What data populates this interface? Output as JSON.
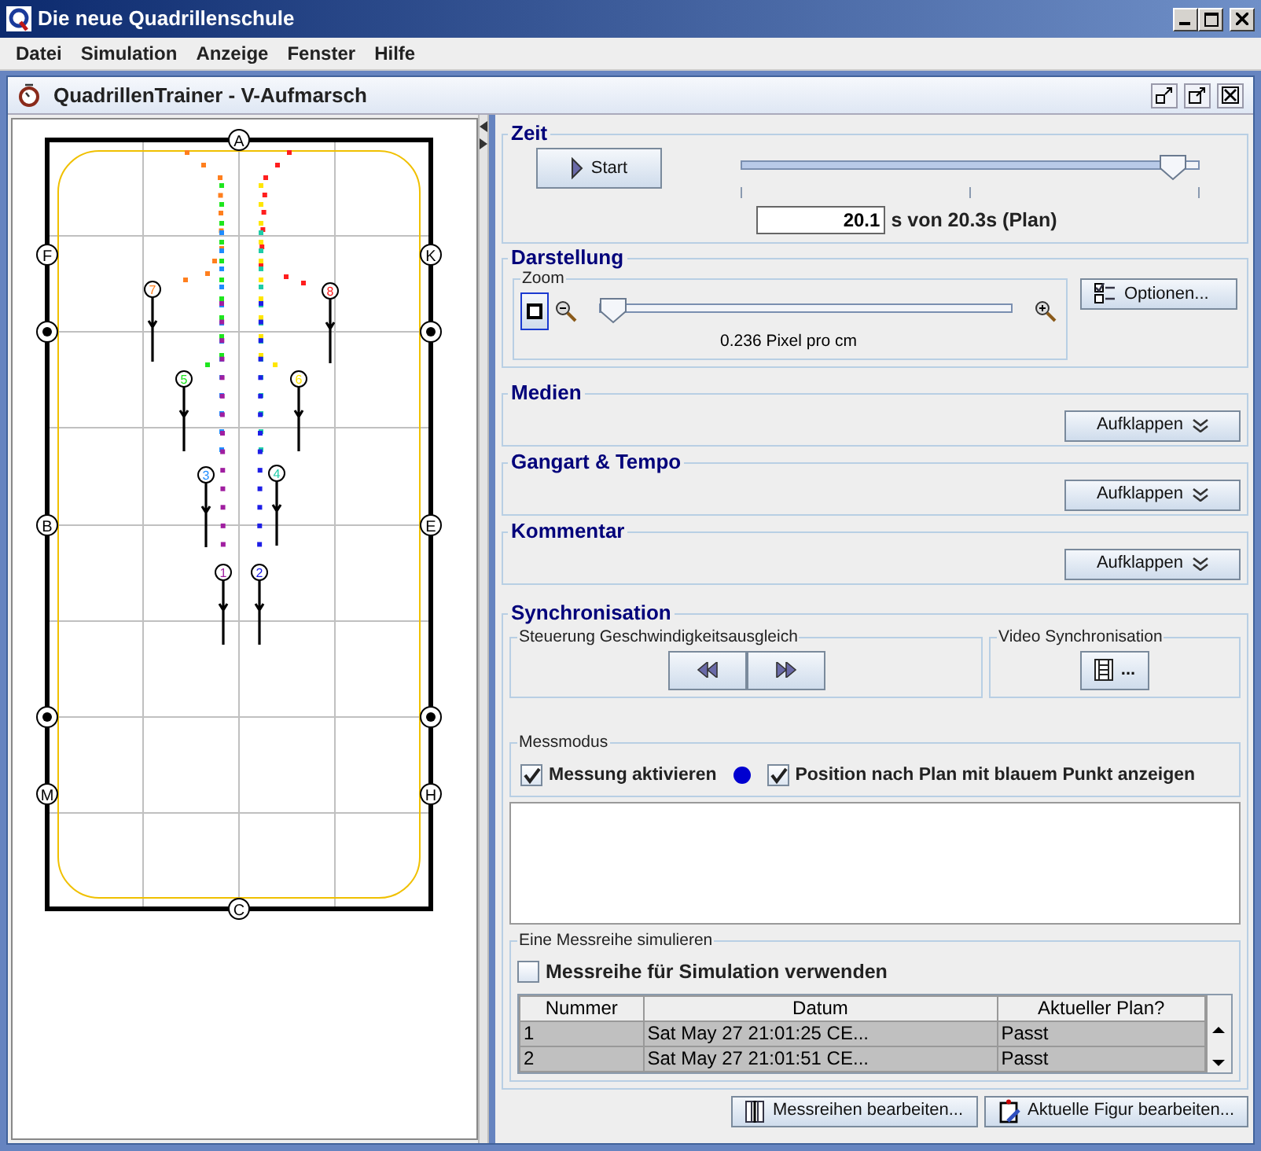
{
  "window": {
    "title": "Die neue Quadrillenschule"
  },
  "menu": [
    "Datei",
    "Simulation",
    "Anzeige",
    "Fenster",
    "Hilfe"
  ],
  "inner_window": {
    "title": "QuadrillenTrainer - V-Aufmarsch"
  },
  "arena": {
    "markers": [
      {
        "kind": "letter",
        "label": "A"
      },
      {
        "kind": "letter",
        "label": "F"
      },
      {
        "kind": "letter",
        "label": "K"
      },
      {
        "kind": "dot"
      },
      {
        "kind": "dot"
      },
      {
        "kind": "letter",
        "label": "B"
      },
      {
        "kind": "letter",
        "label": "E"
      },
      {
        "kind": "dot"
      },
      {
        "kind": "dot"
      },
      {
        "kind": "letter",
        "label": "M"
      },
      {
        "kind": "letter",
        "label": "H"
      },
      {
        "kind": "letter",
        "label": "C"
      }
    ],
    "riders": [
      {
        "number": "7",
        "color": "#ff7f1e"
      },
      {
        "number": "8",
        "color": "#ff1e1e"
      },
      {
        "number": "5",
        "color": "#1ee61e"
      },
      {
        "number": "6",
        "color": "#ffe600"
      },
      {
        "number": "3",
        "color": "#1e8cff"
      },
      {
        "number": "4",
        "color": "#1ecca8"
      },
      {
        "number": "1",
        "color": "#a01ea0"
      },
      {
        "number": "2",
        "color": "#1e1ee6"
      }
    ]
  },
  "zeit": {
    "title": "Zeit",
    "start_button": "Start",
    "level": 0.97,
    "time_value": "20.1",
    "time_text": "s von 20.3s (Plan)"
  },
  "darstellung": {
    "title": "Darstellung",
    "zoom": {
      "title": "Zoom",
      "level": 0.0,
      "reading": "0.236 Pixel pro cm"
    },
    "options_button": "Optionen..."
  },
  "collapsed_sections": [
    {
      "title": "Medien",
      "button": "Aufklappen"
    },
    {
      "title": "Gangart & Tempo",
      "button": "Aufklappen"
    },
    {
      "title": "Kommentar",
      "button": "Aufklappen"
    }
  ],
  "synchronisation": {
    "title": "Synchronisation",
    "speed_group": "Steuerung Geschwindigkeitsausgleich",
    "video_group": "Video Synchronisation",
    "video_button": "..."
  },
  "messmodus": {
    "title": "Messmodus",
    "options": [
      {
        "label": "Messung aktivieren",
        "checked": true
      },
      {
        "label": "Position nach Plan mit blauem Punkt  anzeigen",
        "checked": true
      }
    ]
  },
  "simulation": {
    "title": "Eine Messreihe simulieren",
    "use_checkbox": {
      "label": "Messreihe für Simulation verwenden",
      "checked": false
    },
    "table": {
      "columns": [
        "Nummer",
        "Datum",
        "Aktueller Plan?"
      ],
      "rows": [
        {
          "cells": [
            "1",
            "Sat May 27 21:01:25 CE...",
            "Passt"
          ],
          "selected": true
        },
        {
          "cells": [
            "2",
            "Sat May 27 21:01:51 CE...",
            "Passt"
          ],
          "selected": true
        }
      ]
    }
  },
  "buttons": [
    "Messreihen bearbeiten...",
    "Aktuelle Figur bearbeiten..."
  ]
}
